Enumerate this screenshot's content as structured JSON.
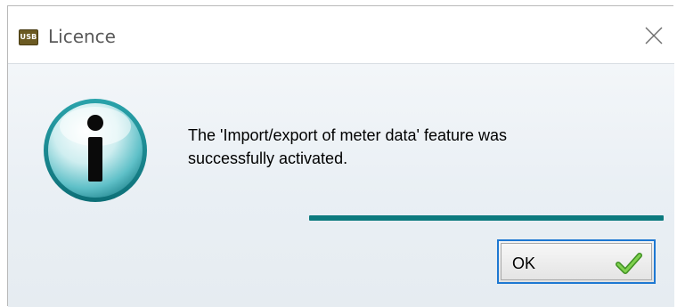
{
  "window": {
    "title": "Licence",
    "app_icon_text": "USB"
  },
  "dialog": {
    "icon": "info-icon",
    "message_line1": "The 'Import/export of meter data' feature was",
    "message_line2": "successfully activated."
  },
  "buttons": {
    "ok_label": "OK",
    "ok_icon": "checkmark-icon",
    "close_icon": "close-icon"
  },
  "colors": {
    "accent_teal": "#0c7a7e",
    "button_focus_border": "#1e78d2",
    "check_green": "#5bb534"
  }
}
